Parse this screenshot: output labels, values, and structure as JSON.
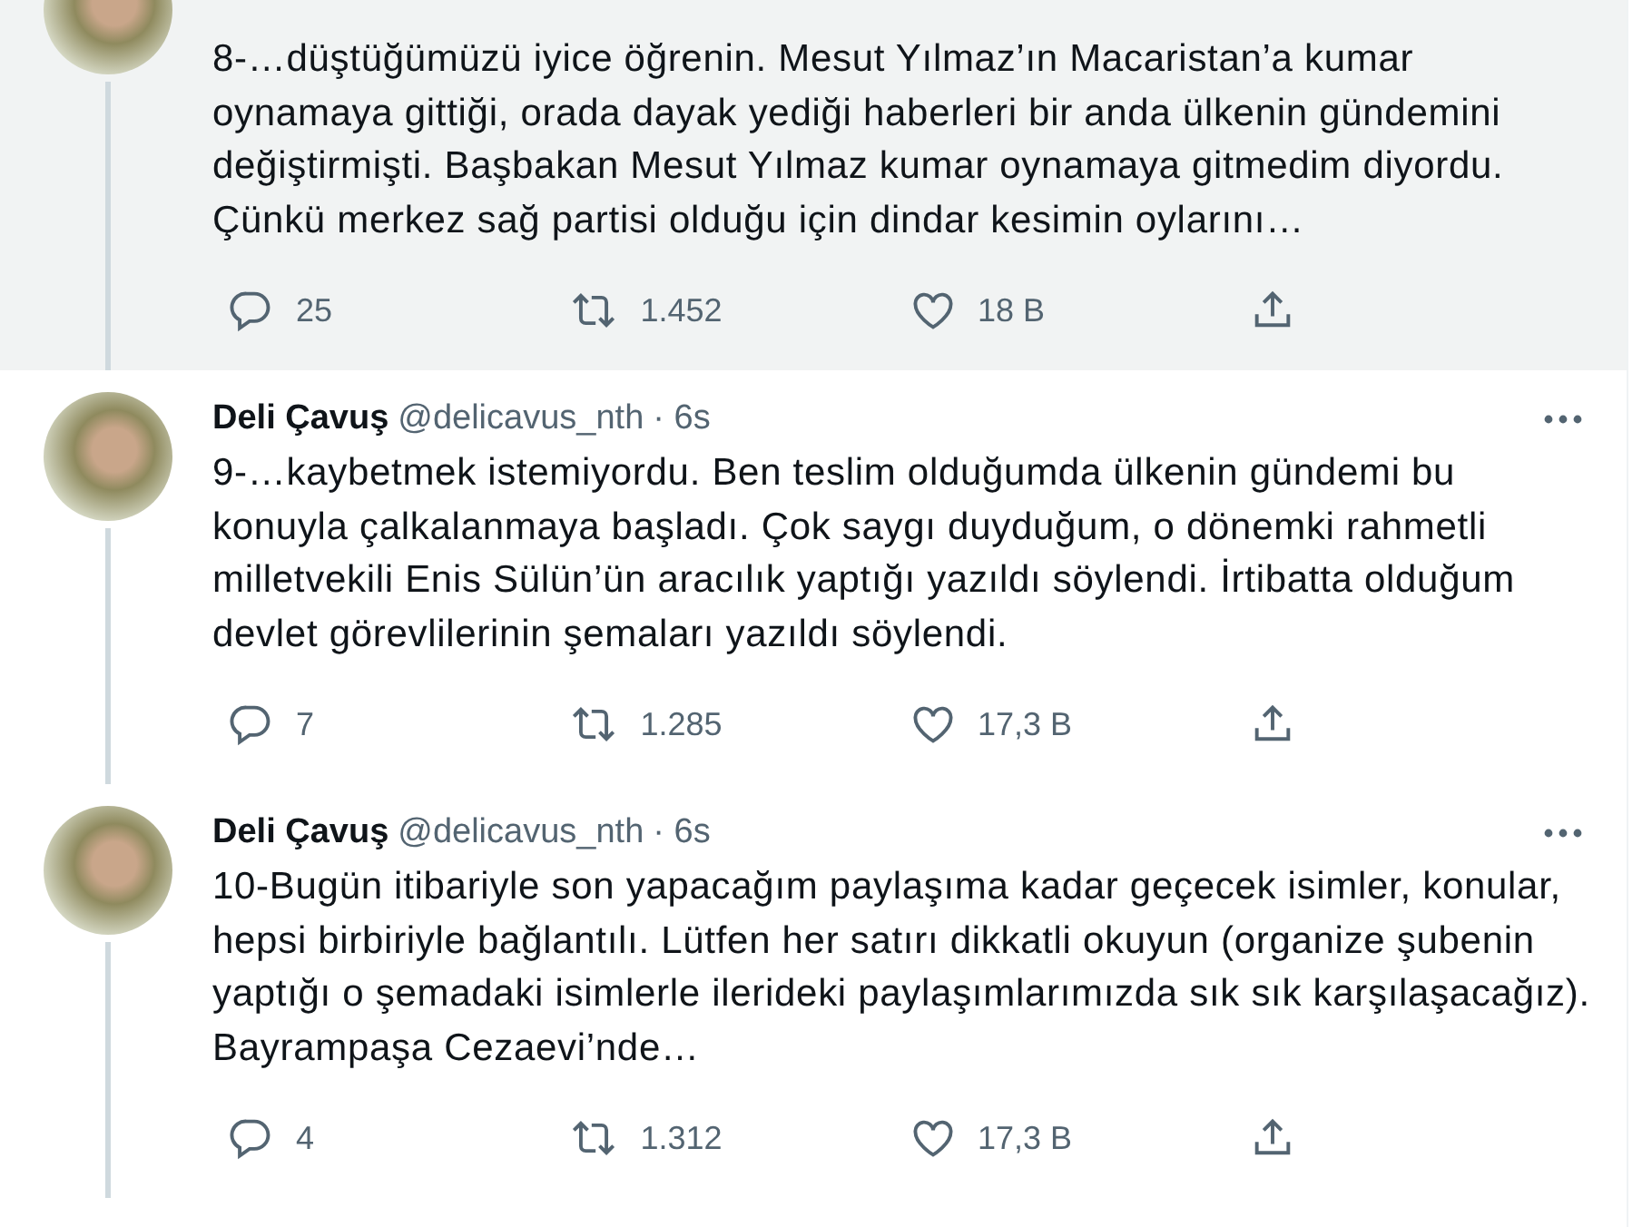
{
  "tweets": [
    {
      "highlighted": true,
      "header_visible": false,
      "text": "8-…düştüğümüzü iyice öğrenin. Mesut Yılmaz’ın Macaristan’a kumar oynamaya gittiği, orada dayak yediği haberleri bir anda ülkenin gündemini değiştirmişti. Başbakan Mesut Yılmaz kumar oynamaya gitmedim diyordu. Çünkü merkez sağ partisi olduğu için dindar kesimin oylarını…",
      "replies": "25",
      "retweets": "1.452",
      "likes": "18 B"
    },
    {
      "highlighted": false,
      "header_visible": true,
      "name": "Deli Çavuş",
      "handle": "@delicavus_nth",
      "time": "· 6s",
      "text": "9-…kaybetmek istemiyordu. Ben teslim olduğumda ülkenin gündemi bu konuyla çalkalanmaya başladı. Çok saygı duyduğum, o dönemki rahmetli milletvekili Enis Sülün’ün aracılık yaptığı yazıldı söylendi. İrtibatta olduğum devlet görevlilerinin şemaları yazıldı söylendi.",
      "replies": "7",
      "retweets": "1.285",
      "likes": "17,3 B"
    },
    {
      "highlighted": false,
      "header_visible": true,
      "name": "Deli Çavuş",
      "handle": "@delicavus_nth",
      "time": "· 6s",
      "text": "10-Bugün itibariyle son yapacağım paylaşıma kadar geçecek isimler, konular, hepsi birbiriyle bağlantılı. Lütfen her satırı dikkatli okuyun (organize şubenin yaptığı o şemadaki isimlerle ilerideki paylaşımlarımızda sık sık karşılaşacağız). Bayrampaşa Cezaevi’nde…",
      "replies": "4",
      "retweets": "1.312",
      "likes": "17,3 B"
    }
  ]
}
